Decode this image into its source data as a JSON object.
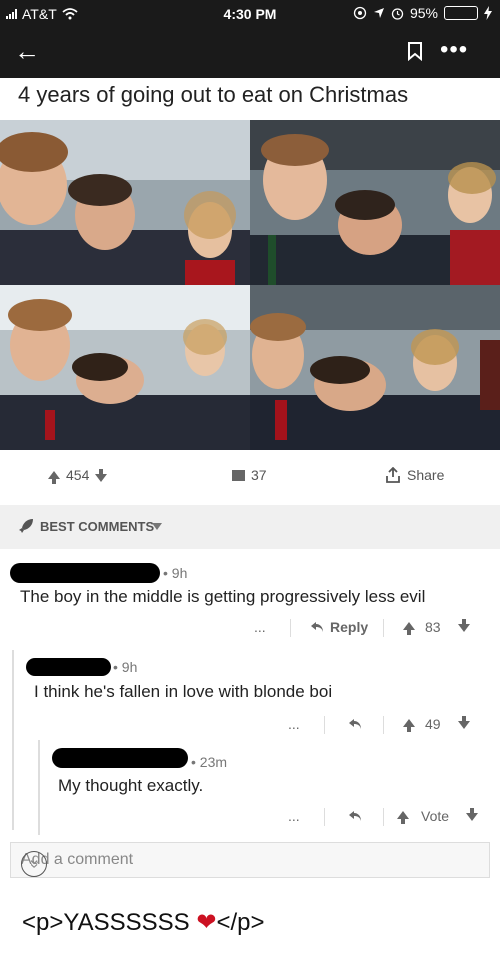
{
  "status_bar": {
    "carrier": "AT&T",
    "time": "4:30 PM",
    "battery": "95%",
    "battery_level": 0.95,
    "icons": [
      "signal-icon",
      "wifi-icon",
      "location-icon",
      "alarm-icon",
      "battery-icon",
      "charging-icon"
    ]
  },
  "app_bar": {
    "back_icon": "←",
    "more_icon": "•••"
  },
  "post": {
    "title": "4 years of going out to eat on Christmas",
    "upvotes": "454",
    "comments": "37",
    "share": "Share"
  },
  "comments_header": {
    "label": "BEST COMMENTS"
  },
  "comments": [
    {
      "time": "• 9h",
      "text": "The boy in the middle is getting progressively less evil",
      "more": "...",
      "reply": "Reply",
      "score": "83"
    },
    {
      "time": "• 9h",
      "text": "I think he's fallen in love with blonde boi",
      "more": "...",
      "score": "49"
    },
    {
      "time": "• 23m",
      "text": "My thought exactly.",
      "more": "...",
      "vote": "Vote"
    }
  ],
  "add_comment": {
    "placeholder": "Add a comment",
    "collapse_icon": "»"
  },
  "caption": {
    "text_before": "<p>YASSSSSS ",
    "heart": "❤",
    "text_after": "</p>"
  },
  "colors": {
    "bar_bg": "#1a1a1a",
    "battery_green": "#4cd964",
    "header_bg": "#f0f0f0",
    "heart": "#cc1122"
  }
}
